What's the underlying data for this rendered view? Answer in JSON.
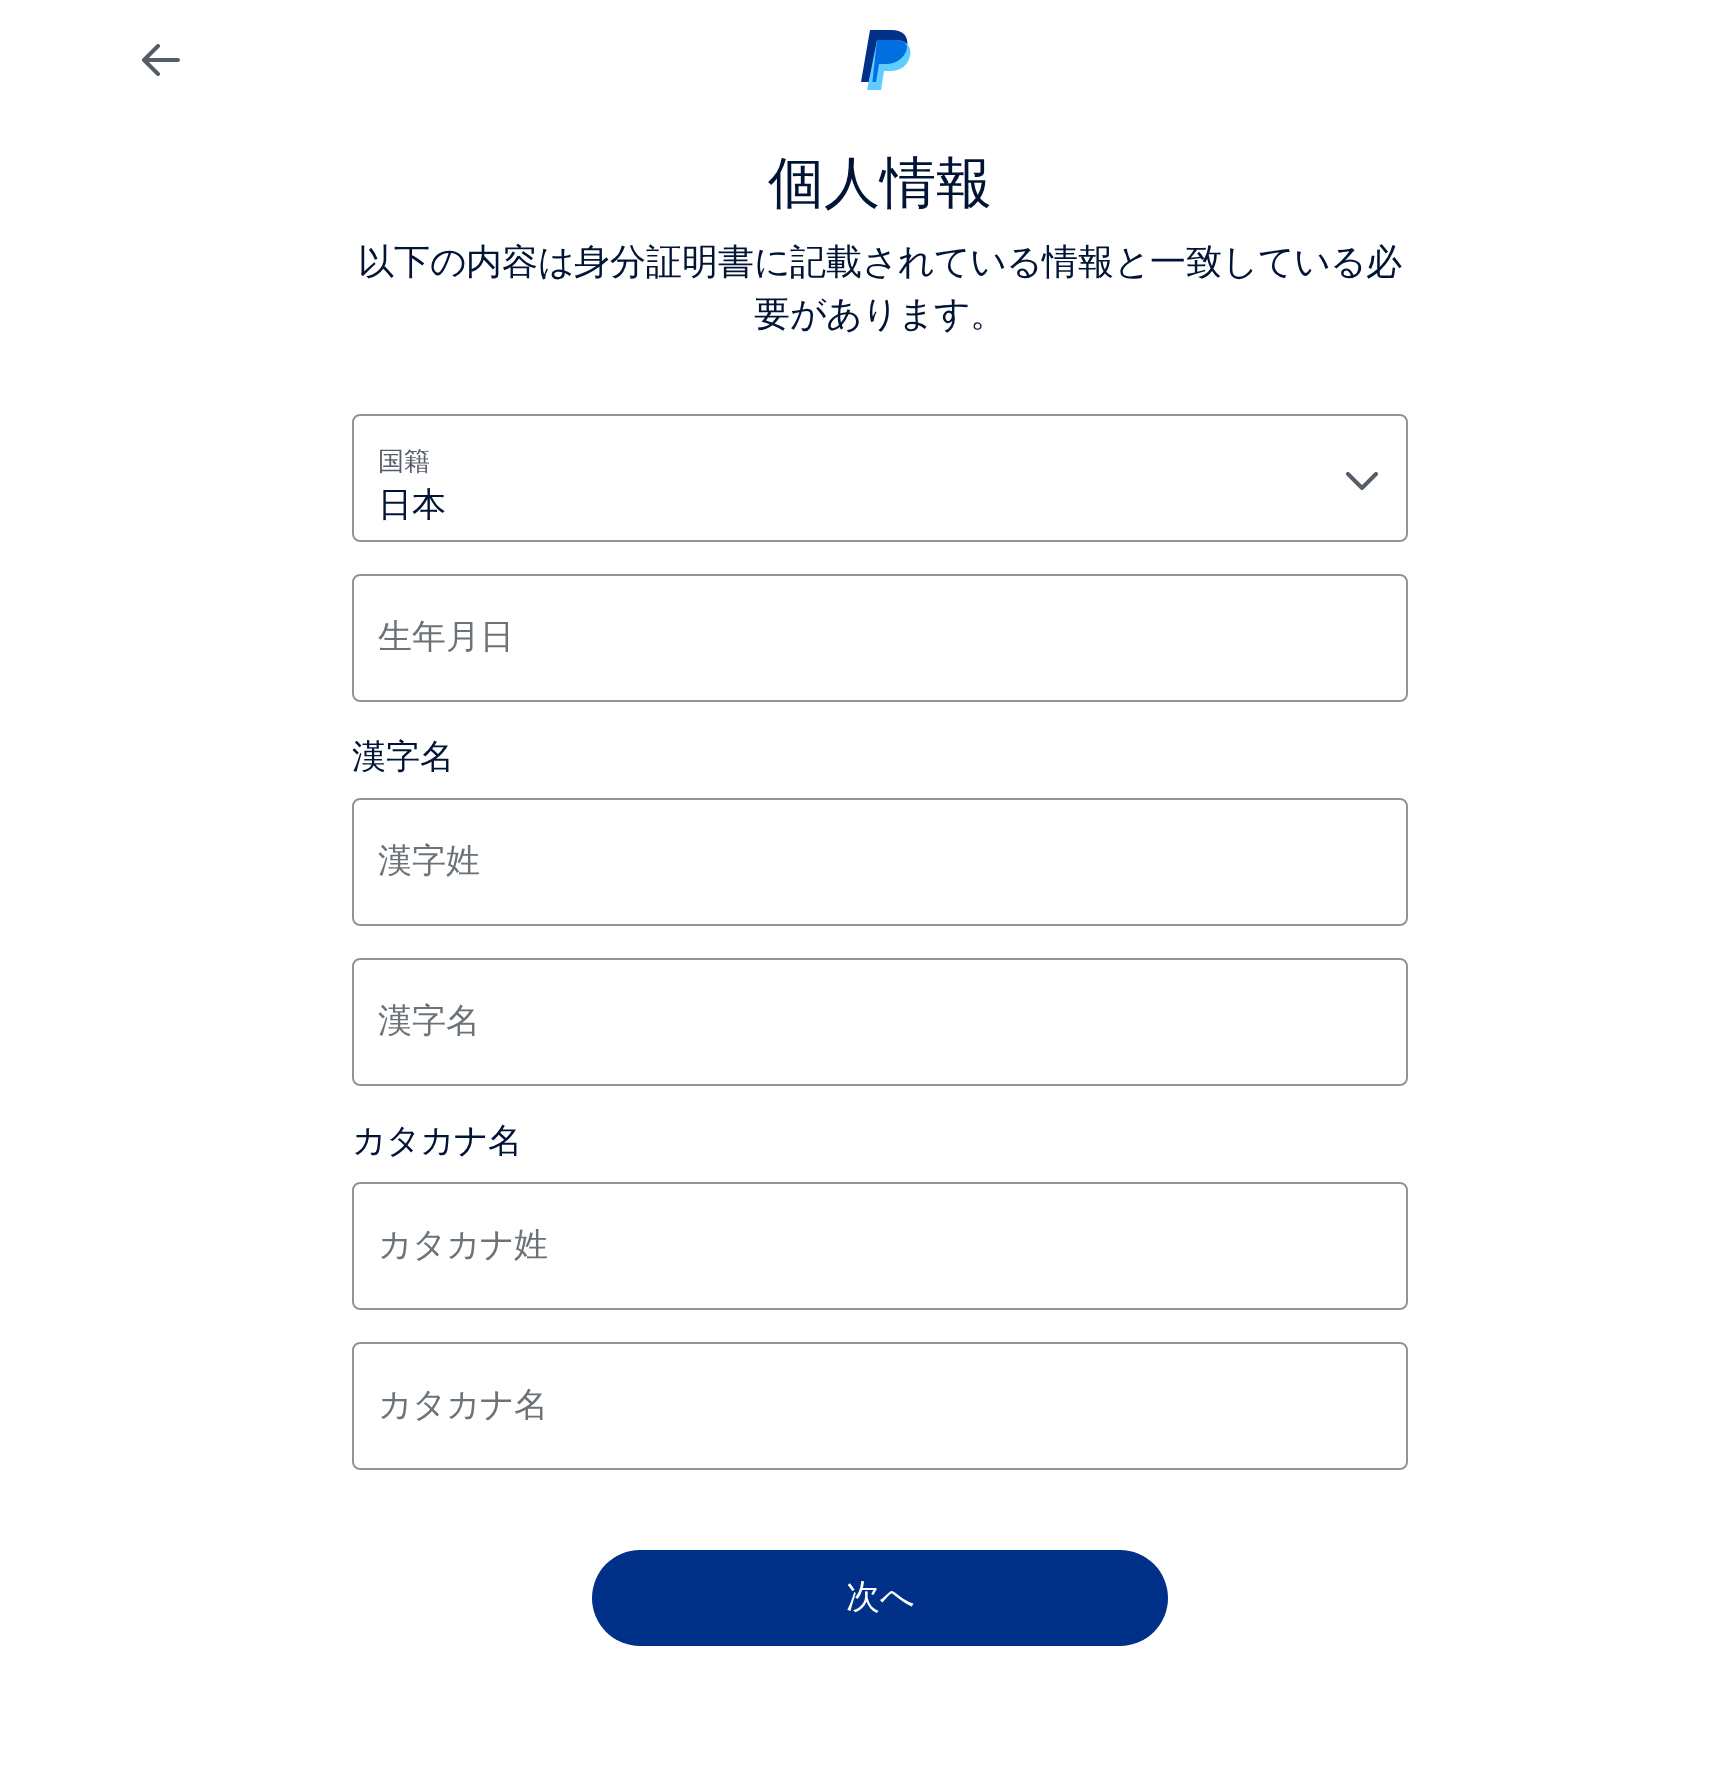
{
  "header": {
    "back_button": {
      "kind": "back"
    },
    "logo": {
      "kind": "p-mark"
    }
  },
  "title": "個人情報",
  "description": "以下の内容は身分証明書に記載されている情報と一致している必要があります。",
  "form": {
    "items": [
      {
        "kind": "select",
        "label": "国籍",
        "value": "日本"
      },
      {
        "kind": "input",
        "placeholder": "生年月日"
      },
      {
        "kind": "heading",
        "text": "漢字名"
      },
      {
        "kind": "input",
        "placeholder": "漢字姓"
      },
      {
        "kind": "input",
        "placeholder": "漢字名"
      },
      {
        "kind": "heading",
        "text": "カタカナ名"
      },
      {
        "kind": "input",
        "placeholder": "カタカナ姓"
      },
      {
        "kind": "input",
        "placeholder": "カタカナ名"
      }
    ]
  },
  "primary_button": "次へ"
}
